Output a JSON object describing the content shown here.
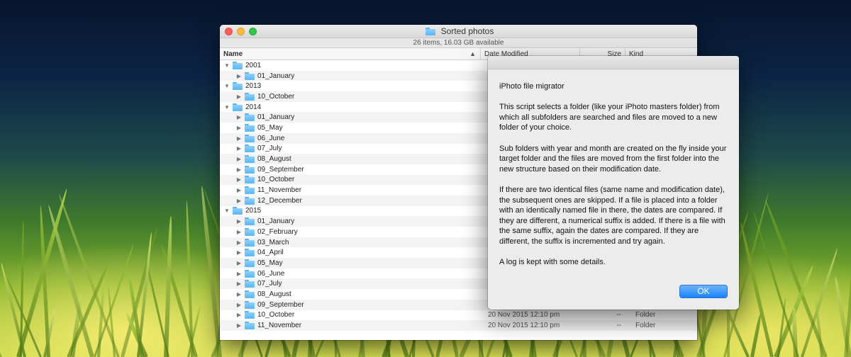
{
  "finder": {
    "title": "Sorted photos",
    "status": "26 items, 16.03 GB available",
    "columns": {
      "name": "Name",
      "date": "Date Modified",
      "size": "Size",
      "kind": "Kind"
    },
    "rows": [
      {
        "name": "2001",
        "level": 0,
        "expanded": true,
        "date": "",
        "size": "",
        "kind": ""
      },
      {
        "name": "01_January",
        "level": 1,
        "expanded": false,
        "date": "",
        "size": "",
        "kind": ""
      },
      {
        "name": "2013",
        "level": 0,
        "expanded": true,
        "date": "",
        "size": "",
        "kind": ""
      },
      {
        "name": "10_October",
        "level": 1,
        "expanded": false,
        "date": "",
        "size": "",
        "kind": ""
      },
      {
        "name": "2014",
        "level": 0,
        "expanded": true,
        "date": "",
        "size": "",
        "kind": ""
      },
      {
        "name": "01_January",
        "level": 1,
        "expanded": false,
        "date": "",
        "size": "",
        "kind": ""
      },
      {
        "name": "05_May",
        "level": 1,
        "expanded": false,
        "date": "",
        "size": "",
        "kind": ""
      },
      {
        "name": "06_June",
        "level": 1,
        "expanded": false,
        "date": "",
        "size": "",
        "kind": ""
      },
      {
        "name": "07_July",
        "level": 1,
        "expanded": false,
        "date": "",
        "size": "",
        "kind": ""
      },
      {
        "name": "08_August",
        "level": 1,
        "expanded": false,
        "date": "",
        "size": "",
        "kind": ""
      },
      {
        "name": "09_September",
        "level": 1,
        "expanded": false,
        "date": "",
        "size": "",
        "kind": ""
      },
      {
        "name": "10_October",
        "level": 1,
        "expanded": false,
        "date": "",
        "size": "",
        "kind": ""
      },
      {
        "name": "11_November",
        "level": 1,
        "expanded": false,
        "date": "",
        "size": "",
        "kind": ""
      },
      {
        "name": "12_December",
        "level": 1,
        "expanded": false,
        "date": "",
        "size": "",
        "kind": ""
      },
      {
        "name": "2015",
        "level": 0,
        "expanded": true,
        "date": "",
        "size": "",
        "kind": ""
      },
      {
        "name": "01_January",
        "level": 1,
        "expanded": false,
        "date": "",
        "size": "",
        "kind": ""
      },
      {
        "name": "02_February",
        "level": 1,
        "expanded": false,
        "date": "",
        "size": "",
        "kind": ""
      },
      {
        "name": "03_March",
        "level": 1,
        "expanded": false,
        "date": "",
        "size": "",
        "kind": ""
      },
      {
        "name": "04_April",
        "level": 1,
        "expanded": false,
        "date": "",
        "size": "",
        "kind": ""
      },
      {
        "name": "05_May",
        "level": 1,
        "expanded": false,
        "date": "",
        "size": "",
        "kind": ""
      },
      {
        "name": "06_June",
        "level": 1,
        "expanded": false,
        "date": "",
        "size": "",
        "kind": ""
      },
      {
        "name": "07_July",
        "level": 1,
        "expanded": false,
        "date": "",
        "size": "",
        "kind": ""
      },
      {
        "name": "08_August",
        "level": 1,
        "expanded": false,
        "date": "",
        "size": "",
        "kind": ""
      },
      {
        "name": "09_September",
        "level": 1,
        "expanded": false,
        "date": "",
        "size": "",
        "kind": ""
      },
      {
        "name": "10_October",
        "level": 1,
        "expanded": false,
        "date": "20 Nov 2015 12:10 pm",
        "size": "--",
        "kind": "Folder"
      },
      {
        "name": "11_November",
        "level": 1,
        "expanded": false,
        "date": "20 Nov 2015 12:10 pm",
        "size": "--",
        "kind": "Folder"
      }
    ]
  },
  "dialog": {
    "heading": "iPhoto file migrator",
    "paragraphs": [
      "This script selects a folder (like your iPhoto masters folder) from which all subfolders are searched and files are moved to a new folder of your choice.",
      "Sub folders with year and month are created on the fly inside your target folder and the files are moved from the first folder into the new structure based on their modification date.",
      "If there are two identical files (same name and modification date), the subsequent ones are skipped. If a file is placed into a folder with an identically named file in there, the dates are compared. If they are different, a numerical suffix is added. If there is a file with the same suffix, again the dates are compared. If they are different, the suffix is incremented and try again.",
      "A log is kept with some details."
    ],
    "ok_label": "OK"
  },
  "colors": {
    "accent": "#1a82fb",
    "folder": "#5cb6f0"
  }
}
